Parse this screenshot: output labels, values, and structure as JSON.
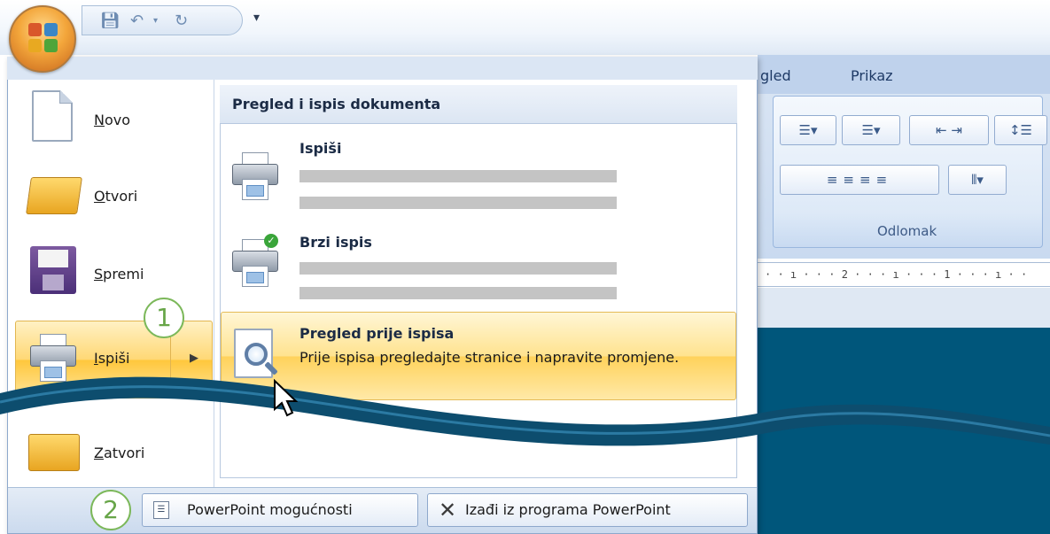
{
  "ribbon": {
    "tabs": [
      "gled",
      "Prikaz"
    ],
    "group_label": "Odlomak",
    "ruler_text": "· · ı · · · 2 · · · ı · · · 1 · · · ı · ·"
  },
  "office_menu": {
    "left_items": [
      {
        "label": "Novo",
        "icon": "new-document-icon"
      },
      {
        "label": "Otvori",
        "icon": "open-folder-icon"
      },
      {
        "label": "Spremi",
        "icon": "save-floppy-icon"
      },
      {
        "label": "Ispiši",
        "icon": "printer-icon",
        "has_submenu": true,
        "selected": true
      },
      {
        "label": "Zatvori",
        "icon": "close-folder-icon"
      }
    ],
    "submenu": {
      "header": "Pregled i ispis dokumenta",
      "items": [
        {
          "title": "Ispiši",
          "icon": "printer-icon"
        },
        {
          "title": "Brzi ispis",
          "icon": "quick-print-icon"
        },
        {
          "title": "Pregled prije ispisa",
          "description": "Prije ispisa pregledajte stranice i napravite promjene.",
          "icon": "print-preview-icon",
          "highlighted": true
        }
      ]
    },
    "bottom_buttons": {
      "options": "PowerPoint mogućnosti",
      "exit": "Izađi iz programa PowerPoint"
    }
  },
  "callouts": [
    "1",
    "2"
  ],
  "colors": {
    "highlight": "#ffd875",
    "callout": "#7cb85a",
    "workspace": "#00567b",
    "wave": "#0d4d6e"
  }
}
